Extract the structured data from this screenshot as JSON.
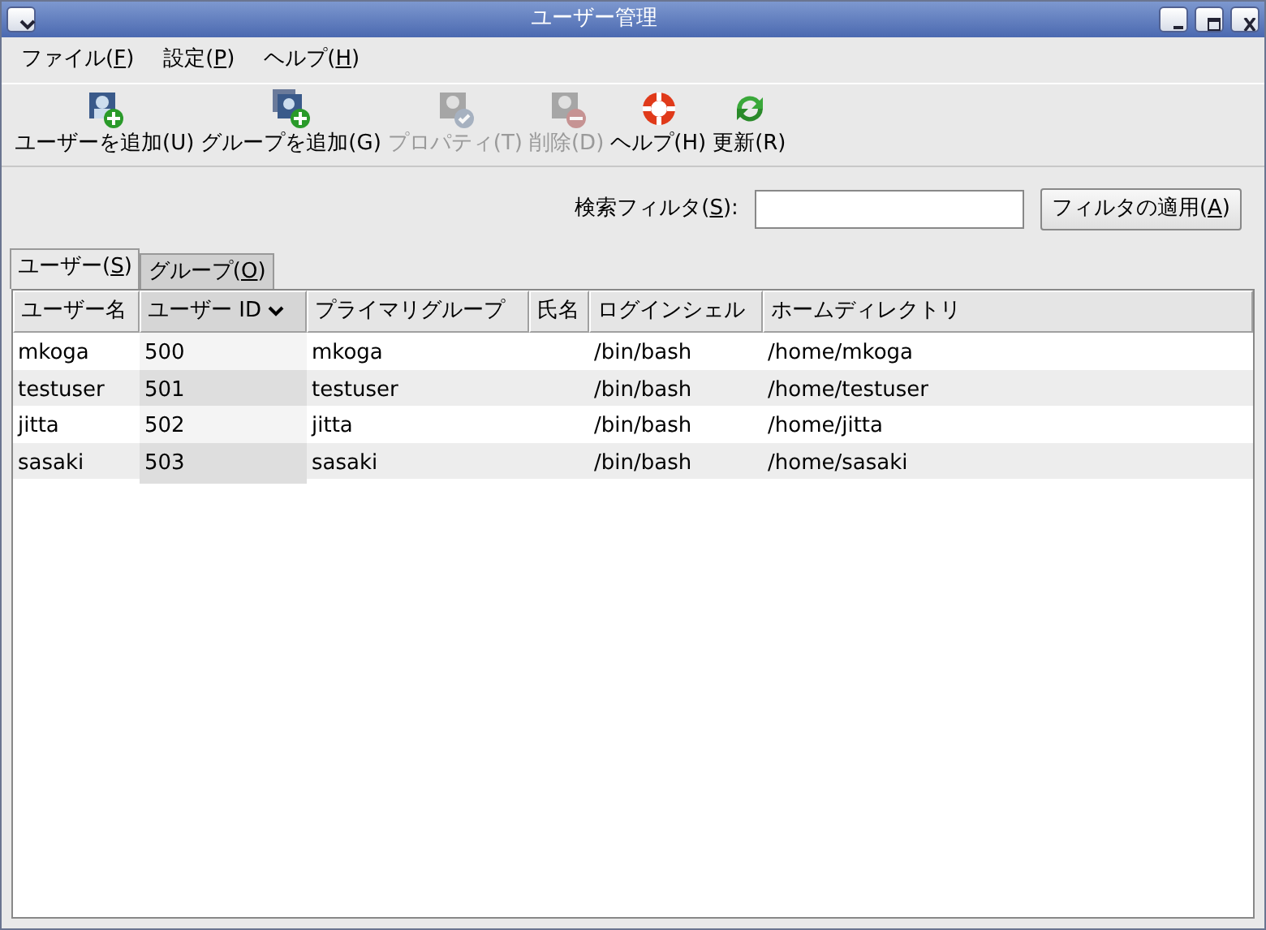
{
  "window": {
    "title": "ユーザー管理"
  },
  "menu": [
    {
      "label": "ファイル(",
      "key": "F",
      "close": ")"
    },
    {
      "label": "設定(",
      "key": "P",
      "close": ")"
    },
    {
      "label": "ヘルプ(",
      "key": "H",
      "close": ")"
    }
  ],
  "toolbar": [
    {
      "kind": "add-user",
      "label": "ユーザーを追加(U)",
      "disabled": false
    },
    {
      "kind": "add-group",
      "label": "グループを追加(G)",
      "disabled": false
    },
    {
      "kind": "properties",
      "label": "プロパティ(T)",
      "disabled": true
    },
    {
      "kind": "delete",
      "label": "削除(D)",
      "disabled": true
    },
    {
      "kind": "help",
      "label": "ヘルプ(H)",
      "disabled": false
    },
    {
      "kind": "refresh",
      "label": "更新(R)",
      "disabled": false
    }
  ],
  "search": {
    "label": "検索フィルタ(",
    "key": "S",
    "close": "):",
    "button": {
      "label": "フィルタの適用(",
      "key": "A",
      "close": ")"
    }
  },
  "tabs": [
    {
      "label": "ユーザー(",
      "key": "S",
      "close": ")",
      "selected": true
    },
    {
      "label": "グループ(",
      "key": "O",
      "close": ")",
      "selected": false
    }
  ],
  "table": {
    "columns": [
      {
        "label": "ユーザー名",
        "sorted": false
      },
      {
        "label": "ユーザー ID",
        "sorted": true
      },
      {
        "label": "プライマリグループ",
        "sorted": false
      },
      {
        "label": "氏名",
        "sorted": false
      },
      {
        "label": "ログインシェル",
        "sorted": false
      },
      {
        "label": "ホームディレクトリ",
        "sorted": false
      }
    ],
    "rows": [
      [
        "mkoga",
        "500",
        "mkoga",
        "",
        "/bin/bash",
        "/home/mkoga"
      ],
      [
        "testuser",
        "501",
        "testuser",
        "",
        "/bin/bash",
        "/home/testuser"
      ],
      [
        "jitta",
        "502",
        "jitta",
        "",
        "/bin/bash",
        "/home/jitta"
      ],
      [
        "sasaki",
        "503",
        "sasaki",
        "",
        "/bin/bash",
        "/home/sasaki"
      ]
    ]
  }
}
